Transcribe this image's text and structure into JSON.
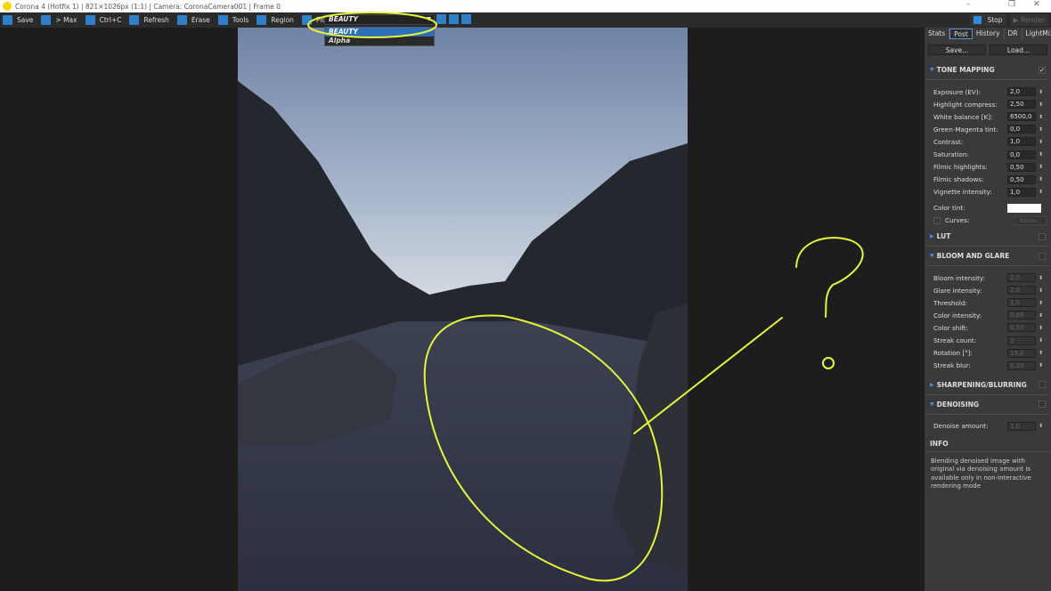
{
  "title": "Corona 4 (Hotfix 1) | 821×1026px (1:1) | Camera: CoronaCamera001 | Frame 0",
  "window": {
    "minimize": "–",
    "maximize": "❐",
    "close": "✕"
  },
  "toolbar": [
    {
      "id": "save",
      "label": "Save"
    },
    {
      "id": "max",
      "label": "> Max"
    },
    {
      "id": "copy",
      "label": "Ctrl+C"
    },
    {
      "id": "refresh",
      "label": "Refresh"
    },
    {
      "id": "erase",
      "label": "Erase"
    },
    {
      "id": "tools",
      "label": "Tools"
    },
    {
      "id": "region",
      "label": "Region"
    },
    {
      "id": "pick",
      "label": "Pick"
    }
  ],
  "pass": {
    "selected": "BEAUTY",
    "options": [
      "BEAUTY",
      "Alpha"
    ]
  },
  "render_controls": {
    "stop": "Stop",
    "render": "Render"
  },
  "tabs": [
    "Stats",
    "Post",
    "History",
    "DR",
    "LightMix"
  ],
  "active_tab": "Post",
  "post": {
    "save": "Save...",
    "load": "Load...",
    "tone_mapping": {
      "title": "TONE MAPPING",
      "enabled": true,
      "rows": [
        {
          "label": "Exposure (EV):",
          "value": "2,0"
        },
        {
          "label": "Highlight compress:",
          "value": "2,50"
        },
        {
          "label": "White balance [K]:",
          "value": "6500,0"
        },
        {
          "label": "Green-Magenta tint:",
          "value": "0,0"
        },
        {
          "label": "Contrast:",
          "value": "1,0"
        },
        {
          "label": "Saturation:",
          "value": "0,0"
        },
        {
          "label": "Filmic highlights:",
          "value": "0,50"
        },
        {
          "label": "Filmic shadows:",
          "value": "0,50"
        },
        {
          "label": "Vignette intensity:",
          "value": "1,0"
        }
      ],
      "color_tint": "Color tint:",
      "color_tint_value": "#ffffff",
      "curves": "Curves:",
      "editor": "Editor..."
    },
    "lut": {
      "title": "LUT"
    },
    "bloom": {
      "title": "BLOOM AND GLARE",
      "rows": [
        {
          "label": "Bloom intensity:",
          "value": "2,0"
        },
        {
          "label": "Glare intensity:",
          "value": "2,0"
        },
        {
          "label": "Threshold:",
          "value": "1,0"
        },
        {
          "label": "Color intensity:",
          "value": "0,80"
        },
        {
          "label": "Color shift:",
          "value": "0,50"
        },
        {
          "label": "Streak count:",
          "value": "3"
        },
        {
          "label": "Rotation [°]:",
          "value": "15,0"
        },
        {
          "label": "Streak blur:",
          "value": "0,20"
        }
      ]
    },
    "sharpening": {
      "title": "SHARPENING/BLURRING"
    },
    "denoising": {
      "title": "DENOISING",
      "rows": [
        {
          "label": "Denoise amount:",
          "value": "1,0"
        }
      ]
    },
    "info": {
      "title": "INFO",
      "text": "Blending denoised image with original via denoising amount is available only in non-interactive rendering mode"
    }
  }
}
